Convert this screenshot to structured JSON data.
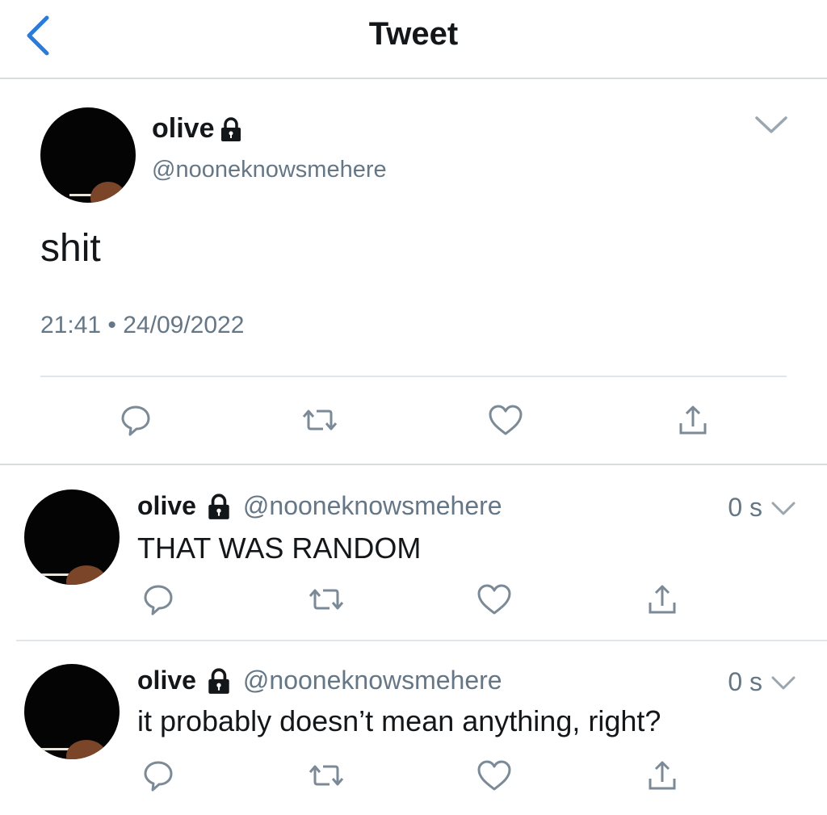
{
  "nav": {
    "title": "Tweet",
    "back_icon": "chevron-left-icon"
  },
  "colors": {
    "accent": "#1da1f2",
    "text": "#14171a",
    "secondary": "#657786",
    "divider": "#e1e6ea",
    "avatar": "#040404"
  },
  "main_tweet": {
    "display_name": "olive",
    "handle": "@nooneknowsmehere",
    "text": "shit",
    "timestamp": "21:41 • 24/09/2022",
    "protected": true,
    "actions": [
      "reply-icon",
      "retweet-icon",
      "like-icon",
      "share-icon"
    ]
  },
  "replies": [
    {
      "display_name": "olive",
      "handle": "@nooneknowsmehere",
      "time": "0 s",
      "text": "THAT WAS RANDOM",
      "protected": true
    },
    {
      "display_name": "olive",
      "handle": "@nooneknowsmehere",
      "time": "0 s",
      "text": "it probably doesn’t mean anything, right?",
      "protected": true
    }
  ]
}
